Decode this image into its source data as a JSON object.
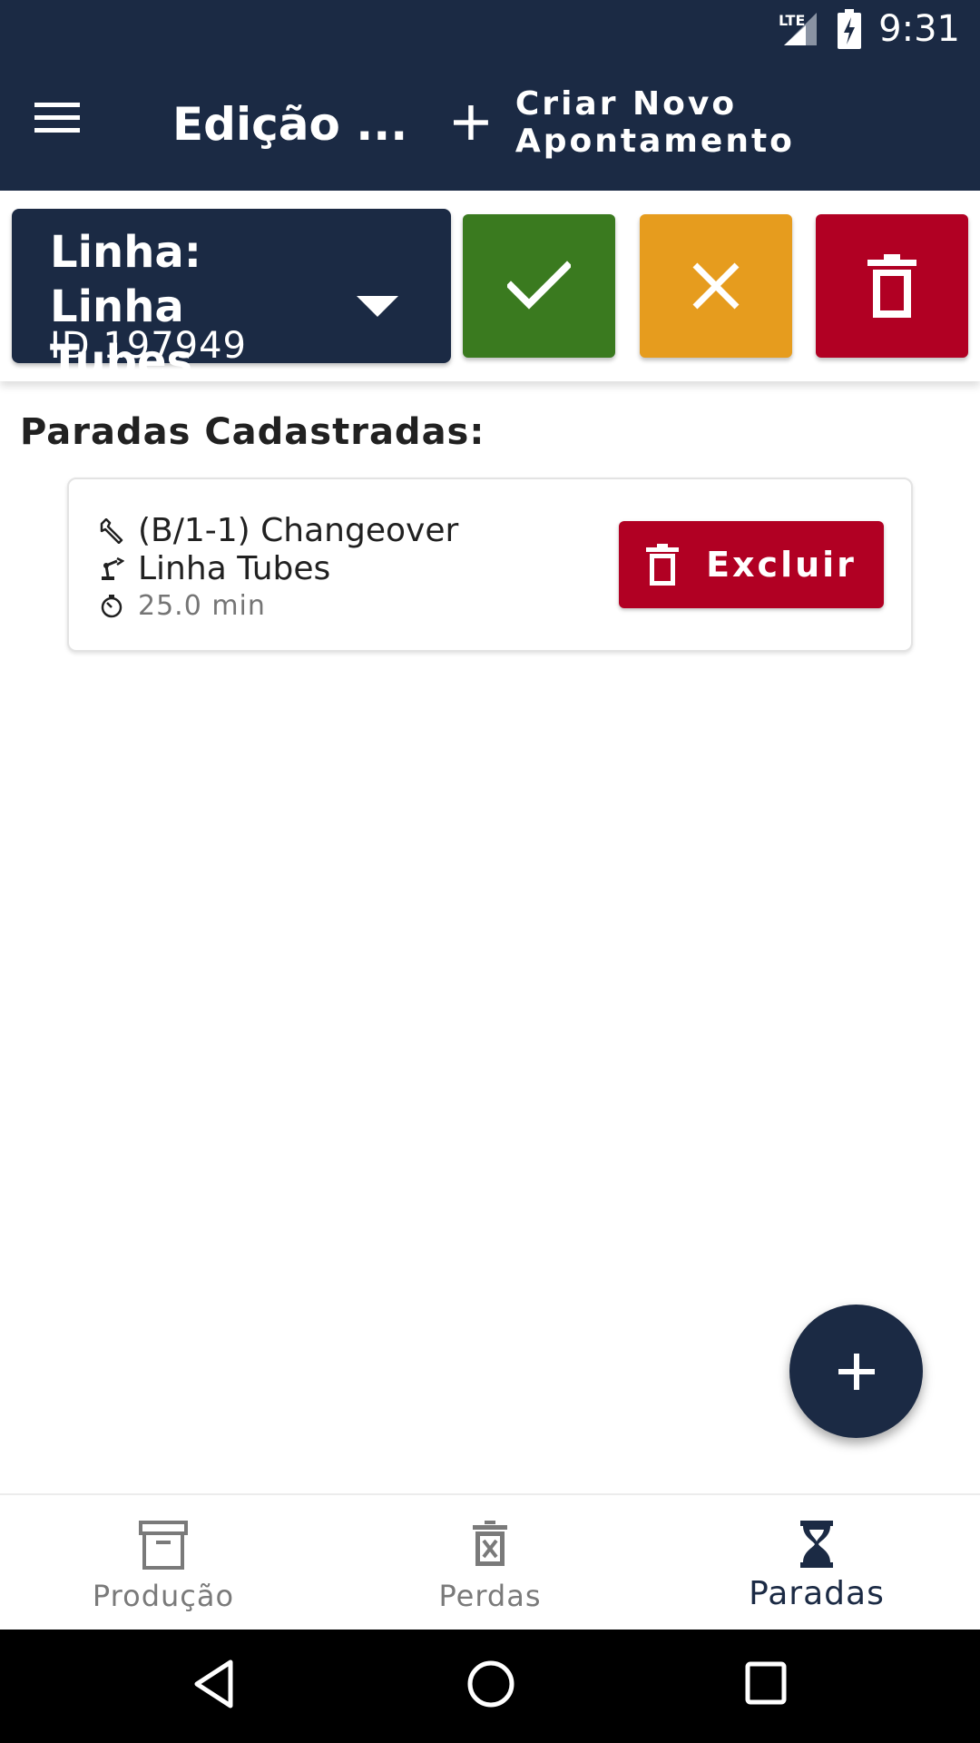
{
  "status_bar": {
    "network": "LTE",
    "time": "9:31"
  },
  "app_bar": {
    "title": "Edição ...",
    "create_label": "Criar Novo Apontamento"
  },
  "line_selector": {
    "name": "Linha: Linha Tubes",
    "id": "ID 197949"
  },
  "actions": {
    "confirm_icon": "check-icon",
    "cancel_icon": "close-icon",
    "delete_icon": "trash-icon"
  },
  "colors": {
    "primary": "#1b2a44",
    "confirm": "#3a7a1f",
    "cancel": "#e69c1e",
    "danger": "#b10023"
  },
  "section": {
    "title": "Paradas Cadastradas:"
  },
  "stops": [
    {
      "reason": "(B/1-1) Changeover",
      "line": "Linha Tubes",
      "duration": "25.0 min",
      "delete_label": "Excluir"
    }
  ],
  "bottom_nav": [
    {
      "label": "Produção",
      "icon": "archive-icon",
      "active": false
    },
    {
      "label": "Perdas",
      "icon": "trash-x-icon",
      "active": false
    },
    {
      "label": "Paradas",
      "icon": "hourglass-icon",
      "active": true
    }
  ]
}
